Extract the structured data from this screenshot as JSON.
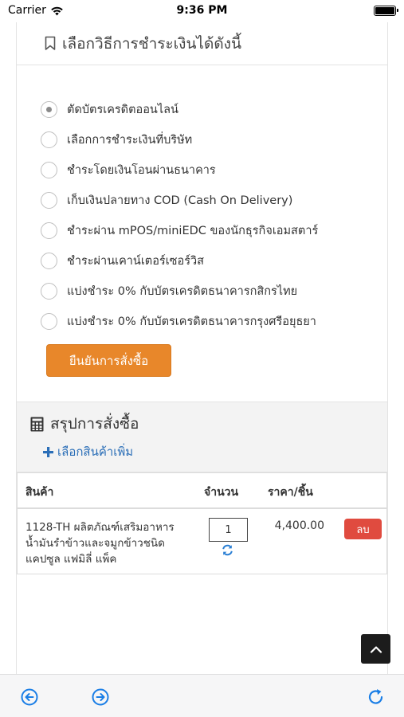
{
  "status_bar": {
    "carrier": "Carrier",
    "time": "9:36 PM"
  },
  "payment": {
    "title": "เลือกวิธีการชำระเงินได้ดังนี้",
    "methods": [
      {
        "label": "ตัดบัตรเครดิตออนไลน์",
        "selected": true
      },
      {
        "label": "เลือกการชำระเงินที่บริษัท",
        "selected": false
      },
      {
        "label": "ชำระโดยเงินโอนผ่านธนาคาร",
        "selected": false
      },
      {
        "label": "เก็บเงินปลายทาง COD (Cash On Delivery)",
        "selected": false
      },
      {
        "label": "ชำระผ่าน mPOS/miniEDC ของนักธุรกิจเอมสตาร์",
        "selected": false
      },
      {
        "label": "ชำระผ่านเคาน์เตอร์เซอร์วิส",
        "selected": false
      },
      {
        "label": "แบ่งชำระ 0% กับบัตรเครดิตธนาคารกสิกรไทย",
        "selected": false
      },
      {
        "label": "แบ่งชำระ 0% กับบัตรเครดิตธนาคารกรุงศรีอยุธยา",
        "selected": false
      }
    ],
    "confirm_label": "ยืนยันการสั่งซื้อ"
  },
  "summary": {
    "title": "สรุปการสั่งซื้อ",
    "add_more_label": "เลือกสินค้าเพิ่ม"
  },
  "table": {
    "headers": {
      "product": "สินค้า",
      "quantity": "จำนวน",
      "price": "ราคา/ชิ้น"
    },
    "rows": [
      {
        "product": "1128-TH ผลิตภัณฑ์เสริมอาหาร น้ำมันรำข้าวและจมูกข้าวชนิดแคปซูล แฟมิลี่ แพ็ค",
        "quantity": "1",
        "price": "4,400.00",
        "delete_label": "ลบ"
      }
    ]
  },
  "colors": {
    "accent_orange": "#e8872a",
    "link_blue": "#2a6eb7",
    "delete_red": "#e04b3f",
    "toolbar_blue": "#1a7ee6"
  },
  "icons": {
    "header": "bookmark-icon",
    "summary": "calculator-icon",
    "add": "plus-icon",
    "quantity_refresh": "refresh-icon",
    "scroll_top": "chevron-up-icon",
    "toolbar_back": "back-arrow-icon",
    "toolbar_forward": "forward-arrow-icon",
    "toolbar_reload": "reload-icon"
  }
}
